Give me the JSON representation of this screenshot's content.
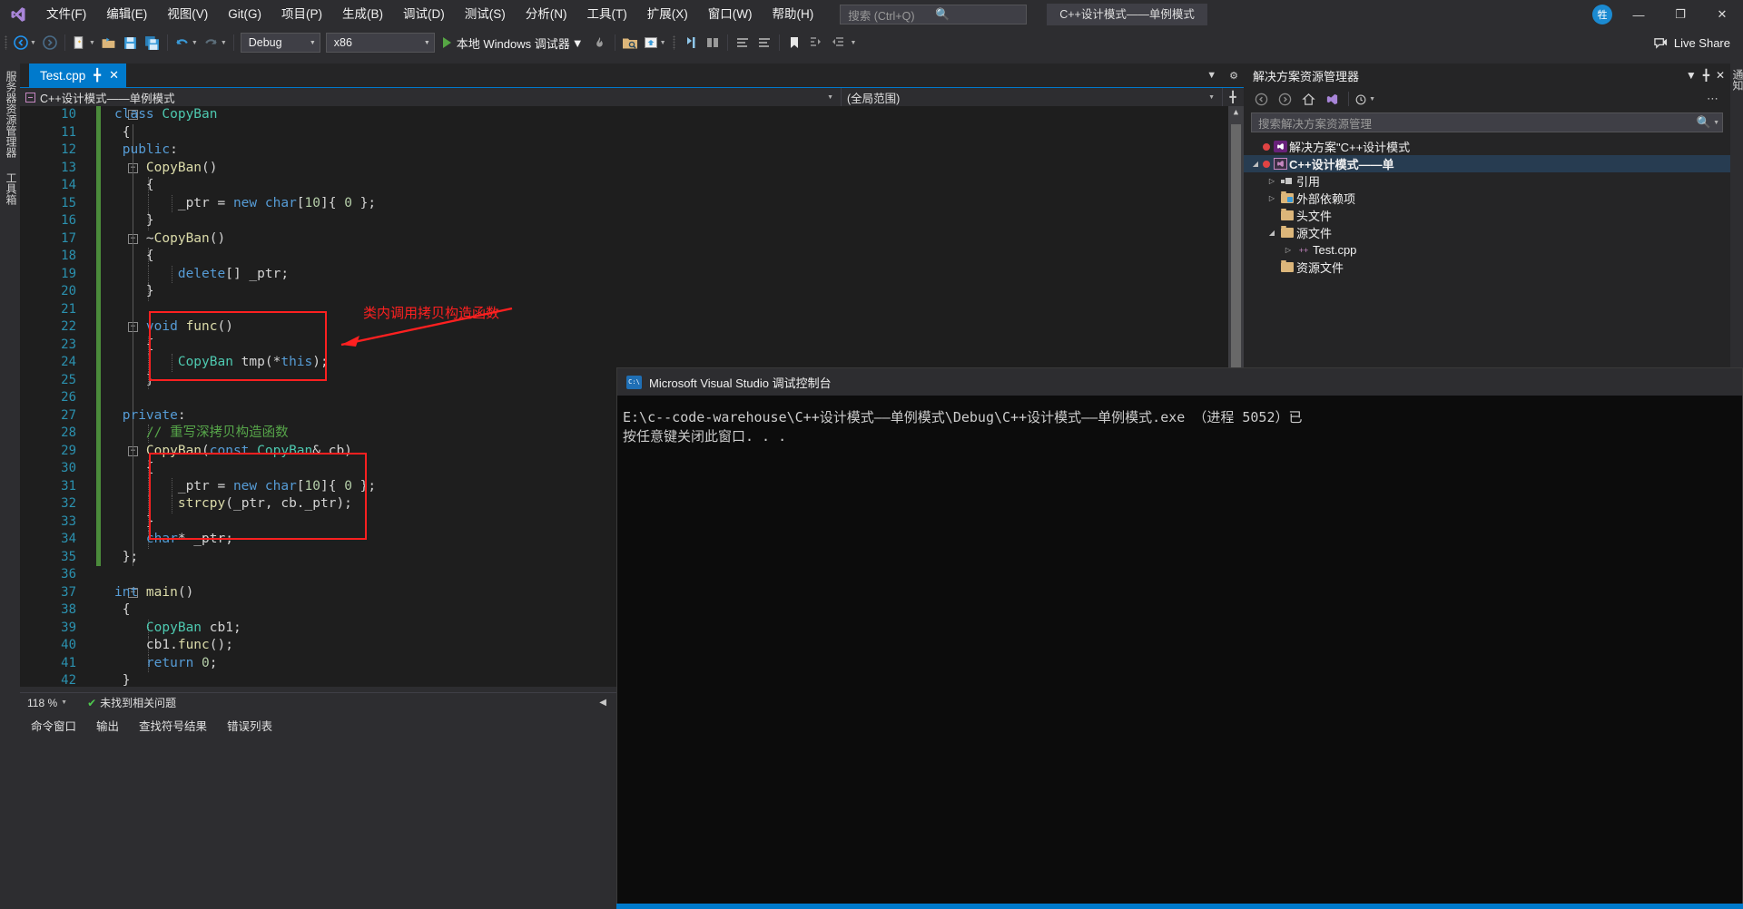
{
  "titlebar": {
    "logo_icon": "visual-studio-logo",
    "menus": [
      {
        "label": "文件(F)"
      },
      {
        "label": "编辑(E)"
      },
      {
        "label": "视图(V)"
      },
      {
        "label": "Git(G)"
      },
      {
        "label": "项目(P)"
      },
      {
        "label": "生成(B)"
      },
      {
        "label": "调试(D)"
      },
      {
        "label": "测试(S)"
      },
      {
        "label": "分析(N)"
      },
      {
        "label": "工具(T)"
      },
      {
        "label": "扩展(X)"
      },
      {
        "label": "窗口(W)"
      },
      {
        "label": "帮助(H)"
      }
    ],
    "search_placeholder": "搜索 (Ctrl+Q)",
    "window_title": "C++设计模式——单例模式",
    "account_initial": "牲",
    "minimize": "—",
    "maximize": "❐",
    "close": "✕"
  },
  "toolbar": {
    "back_icon": "nav-back-icon",
    "forward_icon": "nav-forward-icon",
    "new_icon": "new-file-icon",
    "open_icon": "open-file-icon",
    "save_icon": "save-icon",
    "saveall_icon": "save-all-icon",
    "undo_icon": "undo-icon",
    "redo_icon": "redo-icon",
    "config_value": "Debug",
    "platform_value": "x86",
    "run_label": "本地 Windows 调试器",
    "hot_reload_icon": "hot-reload-icon",
    "find_icon": "find-in-files-icon",
    "preview_icon": "preview-icon",
    "stepinto_icon": "step-into-icon",
    "stepover_icon": "step-over-icon",
    "comment_icon": "comment-icon",
    "uncomment_icon": "uncomment-icon",
    "bookmark_icon": "bookmark-icon",
    "indent1_icon": "increase-indent-icon",
    "indent2_icon": "decrease-indent-icon",
    "live_share_label": "Live Share",
    "live_share_icon": "live-share-icon"
  },
  "left_tabs": [
    {
      "label": "服务器资源管理器"
    },
    {
      "label": "工具箱"
    }
  ],
  "right_tabs": [
    {
      "label": "通知"
    }
  ],
  "editor": {
    "tab_name": "Test.cpp",
    "pin_icon": "pin-icon",
    "close_icon": "close-icon",
    "nav_scope_left": "C++设计模式——单例模式",
    "nav_scope_right": "(全局范围)",
    "dropdown_icon": "chevron-down-icon",
    "settings_icon": "gear-icon",
    "split_icon": "split-view-icon",
    "lines": [
      {
        "no": "10",
        "indent": 0,
        "fold": "minus",
        "tokens": [
          {
            "t": "class ",
            "c": "k"
          },
          {
            "t": "CopyBan",
            "c": "ty"
          }
        ]
      },
      {
        "no": "11",
        "indent": 0,
        "tokens": [
          {
            "t": " {",
            "c": "p"
          }
        ]
      },
      {
        "no": "12",
        "indent": 0,
        "tokens": [
          {
            "t": " ",
            "c": "p"
          },
          {
            "t": "public",
            "c": "k"
          },
          {
            "t": ":",
            "c": "p"
          }
        ]
      },
      {
        "no": "13",
        "indent": 1,
        "fold": "minus",
        "tokens": [
          {
            "t": "    ",
            "c": "p"
          },
          {
            "t": "CopyBan",
            "c": "fn"
          },
          {
            "t": "()",
            "c": "p"
          }
        ]
      },
      {
        "no": "14",
        "indent": 1,
        "tokens": [
          {
            "t": "    {",
            "c": "p"
          }
        ]
      },
      {
        "no": "15",
        "indent": 2,
        "tokens": [
          {
            "t": "        _ptr = ",
            "c": "p"
          },
          {
            "t": "new ",
            "c": "k"
          },
          {
            "t": "char",
            "c": "k"
          },
          {
            "t": "[",
            "c": "p"
          },
          {
            "t": "10",
            "c": "n"
          },
          {
            "t": "]{ ",
            "c": "p"
          },
          {
            "t": "0",
            "c": "n"
          },
          {
            "t": " };",
            "c": "p"
          }
        ]
      },
      {
        "no": "16",
        "indent": 1,
        "tokens": [
          {
            "t": "    }",
            "c": "p"
          }
        ]
      },
      {
        "no": "17",
        "indent": 1,
        "fold": "minus",
        "tokens": [
          {
            "t": "    ~",
            "c": "p"
          },
          {
            "t": "CopyBan",
            "c": "fn"
          },
          {
            "t": "()",
            "c": "p"
          }
        ]
      },
      {
        "no": "18",
        "indent": 1,
        "tokens": [
          {
            "t": "    {",
            "c": "p"
          }
        ]
      },
      {
        "no": "19",
        "indent": 2,
        "tokens": [
          {
            "t": "        ",
            "c": "p"
          },
          {
            "t": "delete",
            "c": "k"
          },
          {
            "t": "[] _ptr;",
            "c": "p"
          }
        ]
      },
      {
        "no": "20",
        "indent": 1,
        "tokens": [
          {
            "t": "    }",
            "c": "p"
          }
        ]
      },
      {
        "no": "21",
        "indent": 0,
        "tokens": [
          {
            "t": "",
            "c": "p"
          }
        ]
      },
      {
        "no": "22",
        "indent": 1,
        "fold": "minus",
        "tokens": [
          {
            "t": "    ",
            "c": "p"
          },
          {
            "t": "void ",
            "c": "k"
          },
          {
            "t": "func",
            "c": "fn"
          },
          {
            "t": "()",
            "c": "p"
          }
        ]
      },
      {
        "no": "23",
        "indent": 1,
        "tokens": [
          {
            "t": "    {",
            "c": "p"
          }
        ]
      },
      {
        "no": "24",
        "indent": 2,
        "tokens": [
          {
            "t": "        ",
            "c": "p"
          },
          {
            "t": "CopyBan",
            "c": "ty"
          },
          {
            "t": " tmp(*",
            "c": "p"
          },
          {
            "t": "this",
            "c": "k"
          },
          {
            "t": ");",
            "c": "p"
          }
        ]
      },
      {
        "no": "25",
        "indent": 1,
        "tokens": [
          {
            "t": "    }",
            "c": "p"
          }
        ]
      },
      {
        "no": "26",
        "indent": 0,
        "tokens": [
          {
            "t": "",
            "c": "p"
          }
        ]
      },
      {
        "no": "27",
        "indent": 0,
        "tokens": [
          {
            "t": " ",
            "c": "p"
          },
          {
            "t": "private",
            "c": "k"
          },
          {
            "t": ":",
            "c": "p"
          }
        ]
      },
      {
        "no": "28",
        "indent": 1,
        "tokens": [
          {
            "t": "    // 重写深拷贝构造函数",
            "c": "c"
          }
        ]
      },
      {
        "no": "29",
        "indent": 1,
        "fold": "minus",
        "tokens": [
          {
            "t": "    ",
            "c": "p"
          },
          {
            "t": "CopyBan",
            "c": "fn"
          },
          {
            "t": "(",
            "c": "p"
          },
          {
            "t": "const ",
            "c": "k"
          },
          {
            "t": "CopyBan",
            "c": "ty"
          },
          {
            "t": "& cb)",
            "c": "p"
          }
        ]
      },
      {
        "no": "30",
        "indent": 1,
        "tokens": [
          {
            "t": "    {",
            "c": "p"
          }
        ]
      },
      {
        "no": "31",
        "indent": 2,
        "tokens": [
          {
            "t": "        _ptr = ",
            "c": "p"
          },
          {
            "t": "new ",
            "c": "k"
          },
          {
            "t": "char",
            "c": "k"
          },
          {
            "t": "[",
            "c": "p"
          },
          {
            "t": "10",
            "c": "n"
          },
          {
            "t": "]{ ",
            "c": "p"
          },
          {
            "t": "0",
            "c": "n"
          },
          {
            "t": " };",
            "c": "p"
          }
        ]
      },
      {
        "no": "32",
        "indent": 2,
        "tokens": [
          {
            "t": "        ",
            "c": "p"
          },
          {
            "t": "strcpy",
            "c": "fn"
          },
          {
            "t": "(_ptr, cb._ptr);",
            "c": "p"
          }
        ]
      },
      {
        "no": "33",
        "indent": 1,
        "tokens": [
          {
            "t": "    }",
            "c": "p"
          }
        ]
      },
      {
        "no": "34",
        "indent": 1,
        "tokens": [
          {
            "t": "    ",
            "c": "p"
          },
          {
            "t": "char",
            "c": "k"
          },
          {
            "t": "* _ptr;",
            "c": "p"
          }
        ]
      },
      {
        "no": "35",
        "indent": 0,
        "tokens": [
          {
            "t": " };",
            "c": "p"
          }
        ]
      },
      {
        "no": "36",
        "indent": 0,
        "tokens": [
          {
            "t": "",
            "c": "p"
          }
        ]
      },
      {
        "no": "37",
        "indent": 0,
        "fold": "minus",
        "tokens": [
          {
            "t": "int ",
            "c": "k"
          },
          {
            "t": "main",
            "c": "fn"
          },
          {
            "t": "()",
            "c": "p"
          }
        ]
      },
      {
        "no": "38",
        "indent": 0,
        "tokens": [
          {
            "t": " {",
            "c": "p"
          }
        ]
      },
      {
        "no": "39",
        "indent": 1,
        "tokens": [
          {
            "t": "    ",
            "c": "p"
          },
          {
            "t": "CopyBan",
            "c": "ty"
          },
          {
            "t": " cb1;",
            "c": "p"
          }
        ]
      },
      {
        "no": "40",
        "indent": 1,
        "tokens": [
          {
            "t": "    cb1.",
            "c": "p"
          },
          {
            "t": "func",
            "c": "fn"
          },
          {
            "t": "();",
            "c": "p"
          }
        ]
      },
      {
        "no": "41",
        "indent": 1,
        "tokens": [
          {
            "t": "    ",
            "c": "p"
          },
          {
            "t": "return ",
            "c": "k"
          },
          {
            "t": "0",
            "c": "n"
          },
          {
            "t": ";",
            "c": "p"
          }
        ]
      },
      {
        "no": "42",
        "indent": 0,
        "tokens": [
          {
            "t": " }",
            "c": "p"
          }
        ]
      }
    ],
    "annotation_text": "类内调用拷贝构造函数"
  },
  "status": {
    "zoom_level": "118 %",
    "problem_text": "未找到相关问题",
    "check_icon": "check-circle-icon",
    "panels": [
      "命令窗口",
      "输出",
      "查找符号结果",
      "错误列表"
    ]
  },
  "solution_explorer": {
    "title": "解决方案资源管理器",
    "dropdown_icon": "chevron-down-icon",
    "pin_icon": "pin-icon",
    "close_icon": "close-icon",
    "toolbar_icons": [
      "back-icon",
      "forward-icon",
      "home-icon",
      "switch-views-icon",
      "pending-changes-icon",
      "overflow-icon"
    ],
    "search_placeholder": "搜索解决方案资源管理",
    "search_icon": "search-icon",
    "tree": [
      {
        "label": "解决方案\"C++设计模式",
        "level": 0,
        "arrow": "",
        "icon": "solution-icon",
        "dot": true,
        "bold": false
      },
      {
        "label": "C++设计模式——单",
        "level": 0,
        "arrow": "▲",
        "icon": "project-icon",
        "dot": true,
        "bold": true,
        "selected": true
      },
      {
        "label": "引用",
        "level": 1,
        "arrow": "▷",
        "icon": "references-icon",
        "dot": false,
        "bold": false
      },
      {
        "label": "外部依赖项",
        "level": 1,
        "arrow": "▷",
        "icon": "folder-blue-icon",
        "dot": false,
        "bold": false
      },
      {
        "label": "头文件",
        "level": 1,
        "arrow": "",
        "icon": "folder-icon",
        "dot": false,
        "bold": false
      },
      {
        "label": "源文件",
        "level": 1,
        "arrow": "▲",
        "icon": "folder-icon",
        "dot": false,
        "bold": false
      },
      {
        "label": "Test.cpp",
        "level": 2,
        "arrow": "▷",
        "icon": "cpp-file-icon",
        "dot": false,
        "bold": false
      },
      {
        "label": "资源文件",
        "level": 1,
        "arrow": "",
        "icon": "folder-icon",
        "dot": false,
        "bold": false
      }
    ]
  },
  "console": {
    "icon": "console-icon",
    "title": "Microsoft Visual Studio 调试控制台",
    "line1": "E:\\c--code-warehouse\\C++设计模式——单例模式\\Debug\\C++设计模式——单例模式.exe （进程 5052）已",
    "line2": "按任意键关闭此窗口. . ."
  }
}
